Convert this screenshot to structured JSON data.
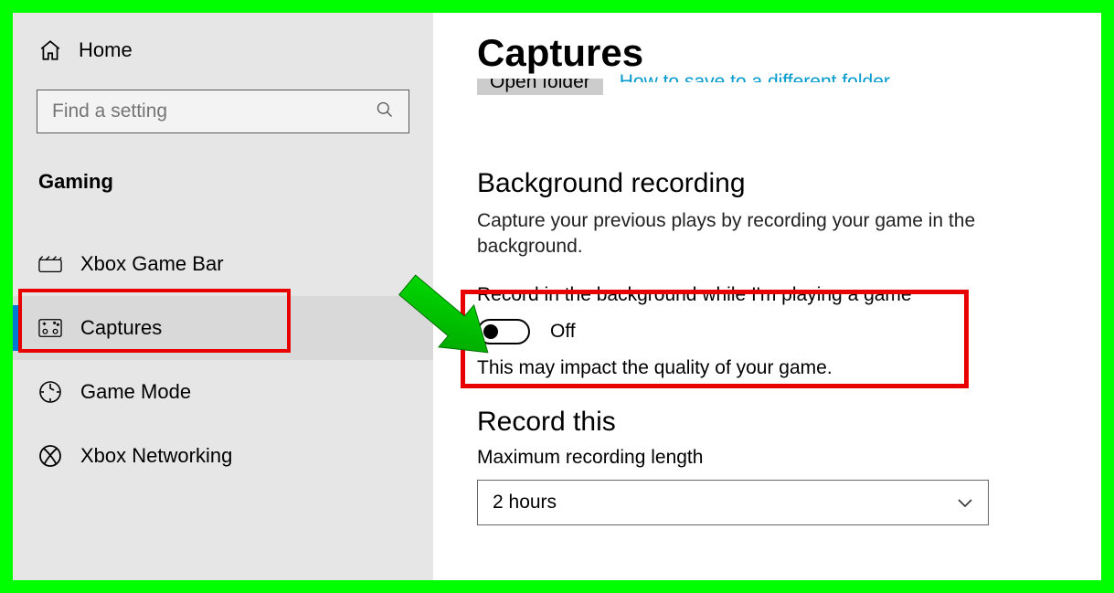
{
  "sidebar": {
    "home_label": "Home",
    "search_placeholder": "Find a setting",
    "category": "Gaming",
    "items": [
      {
        "label": "Xbox Game Bar"
      },
      {
        "label": "Captures"
      },
      {
        "label": "Game Mode"
      },
      {
        "label": "Xbox Networking"
      }
    ]
  },
  "main": {
    "title": "Captures",
    "open_folder_btn": "Open folder",
    "save_link": "How to save to a different folder",
    "bg_heading": "Background recording",
    "bg_desc": "Capture your previous plays by recording your game in the background.",
    "toggle_label": "Record in the background while I'm playing a game",
    "toggle_state": "Off",
    "impact_note": "This may impact the quality of your game.",
    "record_this_heading": "Record this",
    "max_length_label": "Maximum recording length",
    "dropdown_value": "2 hours"
  }
}
